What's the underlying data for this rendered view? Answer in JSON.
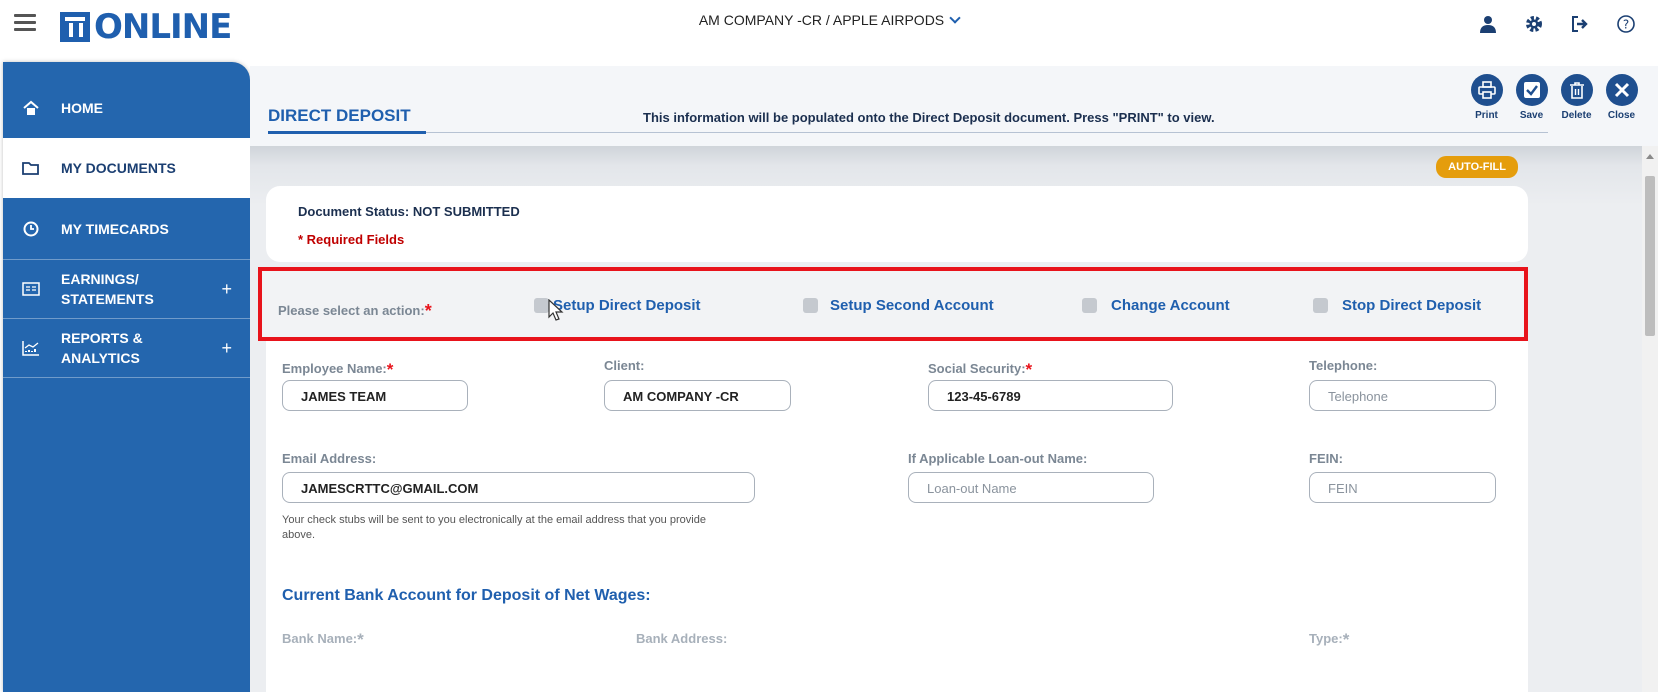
{
  "header": {
    "logo_text": "ONLINE",
    "company_selector": "AM COMPANY -CR / APPLE AIRPODS",
    "icons": [
      "user-icon",
      "gear-icon",
      "logout-icon",
      "help-icon"
    ]
  },
  "sidebar": {
    "items": [
      {
        "label": "HOME",
        "icon": "home-icon"
      },
      {
        "label": "MY DOCUMENTS",
        "icon": "folder-icon",
        "active": true
      },
      {
        "label": "MY TIMECARDS",
        "icon": "clock-icon"
      },
      {
        "label_line1": "EARNINGS/",
        "label_line2": "STATEMENTS",
        "icon": "statement-icon",
        "expand": "+"
      },
      {
        "label_line1": "REPORTS &",
        "label_line2": "ANALYTICS",
        "icon": "chart-icon",
        "expand": "+"
      }
    ]
  },
  "page": {
    "title": "DIRECT DEPOSIT",
    "info": "This information will be populated onto the Direct Deposit document. Press \"PRINT\" to view.",
    "actions": [
      {
        "label": "Print",
        "icon": "print-icon"
      },
      {
        "label": "Save",
        "icon": "save-icon"
      },
      {
        "label": "Delete",
        "icon": "trash-icon"
      },
      {
        "label": "Close",
        "icon": "close-icon"
      }
    ],
    "autofill": "AUTO-FILL"
  },
  "status": {
    "document_status": "Document Status:  NOT SUBMITTED",
    "required_note": "* Required Fields"
  },
  "action_select": {
    "prompt": "Please select an action:",
    "options": [
      "Setup Direct Deposit",
      "Setup Second Account",
      "Change Account",
      "Stop Direct Deposit"
    ]
  },
  "form": {
    "employee_name": {
      "label": "Employee Name:",
      "value": "JAMES TEAM"
    },
    "client": {
      "label": "Client:",
      "value": "AM COMPANY -CR"
    },
    "ssn": {
      "label": "Social Security:",
      "value": "123-45-6789"
    },
    "telephone": {
      "label": "Telephone:",
      "placeholder": "Telephone"
    },
    "email": {
      "label": "Email Address:",
      "value": "JAMESCRTTC@GMAIL.COM"
    },
    "loanout": {
      "label": "If Applicable Loan-out Name:",
      "placeholder": "Loan-out Name"
    },
    "fein": {
      "label": "FEIN:",
      "placeholder": "FEIN"
    },
    "email_note": "Your check stubs will be sent to you electronically at the email address that you provide above.",
    "bank_section_title": "Current Bank Account for Deposit of Net Wages:",
    "bank_name_label": "Bank Name:",
    "bank_address_label": "Bank Address:",
    "type_label": "Type:"
  },
  "required_mark": "*",
  "colors": {
    "brand_blue": "#1f5fae",
    "sidebar_blue": "#2466ae",
    "required_red": "#c00000",
    "highlight_red": "#e8131b",
    "autofill_orange": "#e59d0c"
  }
}
